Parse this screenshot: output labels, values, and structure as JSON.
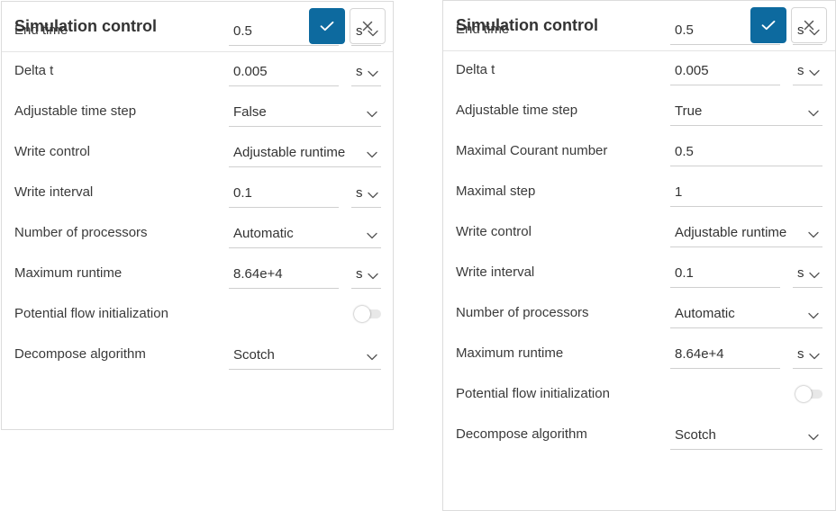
{
  "colors": {
    "accent": "#0d6a9f",
    "border": "#dcdcdc",
    "text": "#333333"
  },
  "icons": {
    "confirm": "check-icon",
    "close": "close-icon",
    "dropdown": "chevron-down-icon"
  },
  "panels": [
    {
      "title": "Simulation control",
      "rows": [
        {
          "label": "End time",
          "value": "0.5",
          "unit": "s"
        },
        {
          "label": "Delta t",
          "value": "0.005",
          "unit": "s"
        },
        {
          "label": "Adjustable time step",
          "value": "False"
        },
        {
          "label": "Write control",
          "value": "Adjustable runtime"
        },
        {
          "label": "Write interval",
          "value": "0.1",
          "unit": "s"
        },
        {
          "label": "Number of processors",
          "value": "Automatic"
        },
        {
          "label": "Maximum runtime",
          "value": "8.64e+4",
          "unit": "s"
        },
        {
          "label": "Potential flow initialization",
          "toggle": false
        },
        {
          "label": "Decompose algorithm",
          "value": "Scotch"
        }
      ]
    },
    {
      "title": "Simulation control",
      "rows": [
        {
          "label": "End time",
          "value": "0.5",
          "unit": "s"
        },
        {
          "label": "Delta t",
          "value": "0.005",
          "unit": "s"
        },
        {
          "label": "Adjustable time step",
          "value": "True"
        },
        {
          "label": "Maximal Courant number",
          "value": "0.5"
        },
        {
          "label": "Maximal step",
          "value": "1"
        },
        {
          "label": "Write control",
          "value": "Adjustable runtime"
        },
        {
          "label": "Write interval",
          "value": "0.1",
          "unit": "s"
        },
        {
          "label": "Number of processors",
          "value": "Automatic"
        },
        {
          "label": "Maximum runtime",
          "value": "8.64e+4",
          "unit": "s"
        },
        {
          "label": "Potential flow initialization",
          "toggle": false
        },
        {
          "label": "Decompose algorithm",
          "value": "Scotch"
        }
      ]
    }
  ]
}
